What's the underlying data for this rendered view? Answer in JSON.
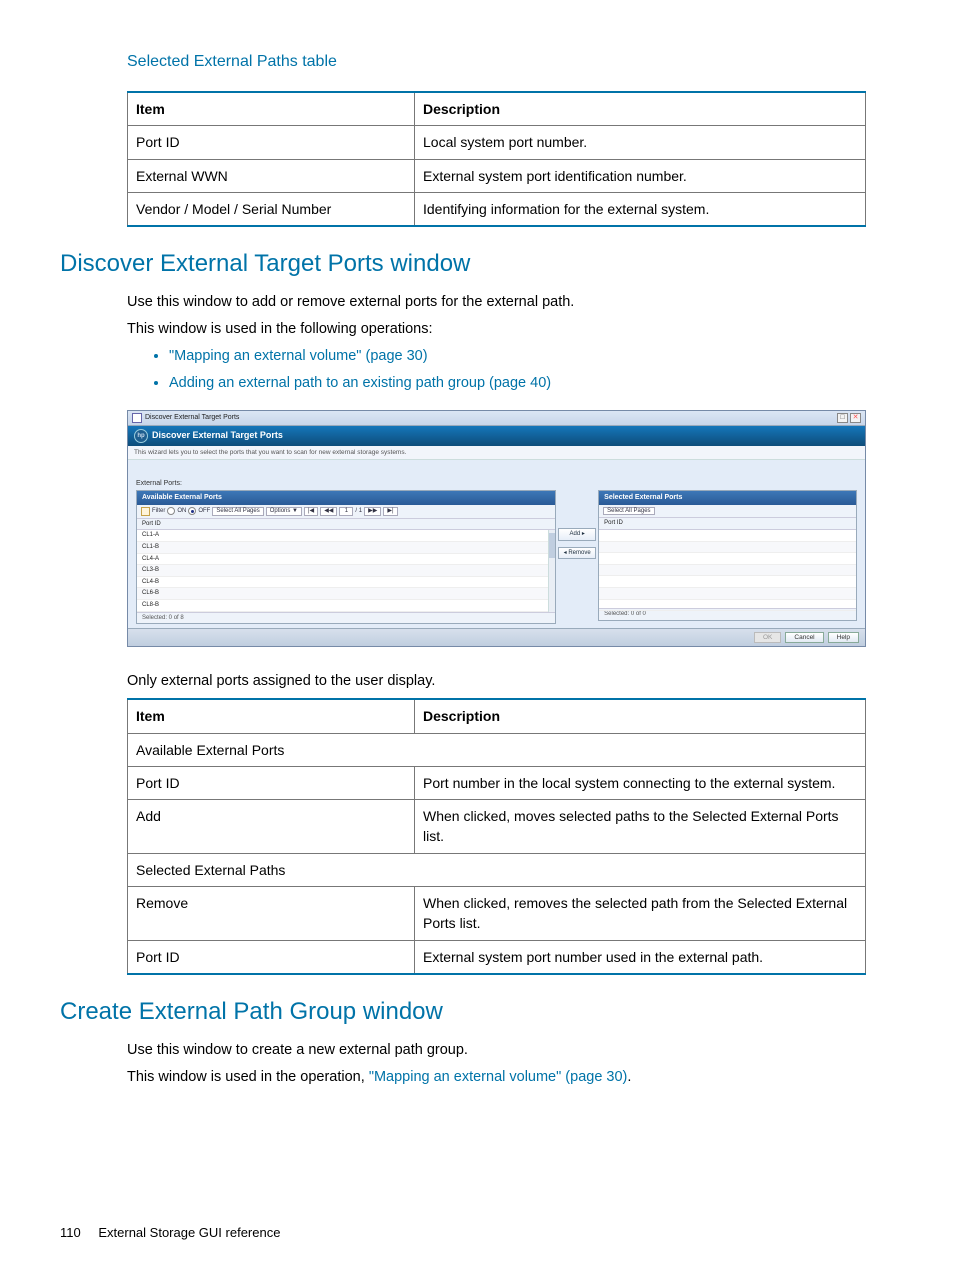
{
  "subheading1": "Selected External Paths table",
  "table1": {
    "headers": [
      "Item",
      "Description"
    ],
    "rows": [
      [
        "Port ID",
        "Local system port number."
      ],
      [
        "External WWN",
        "External system port identification number."
      ],
      [
        "Vendor / Model / Serial Number",
        "Identifying information for the external system."
      ]
    ]
  },
  "section1_title": "Discover External Target Ports window",
  "section1_p1": "Use this window to add or remove external ports for the external path.",
  "section1_p2": "This window is used in the following operations:",
  "bullets1": [
    {
      "text": "\"Mapping an external volume\" (page 30)",
      "link": true
    },
    {
      "text": "Adding an external path to an existing path group (page 40)",
      "link": true
    }
  ],
  "app": {
    "title": "Discover External Target Ports",
    "subtitle": "Discover External Target Ports",
    "desc": "This wizard lets you to select the ports that you want to scan for new external storage systems.",
    "ep_label": "External Ports:",
    "left_head": "Available External Ports",
    "right_head": "Selected External Ports",
    "filter_label": "Filter",
    "on_label": "ON",
    "off_label": "OFF",
    "select_all": "Select All Pages",
    "options": "Options ▼",
    "nav_first": "|◀",
    "nav_prev": "◀◀",
    "page_cur": "1",
    "page_sep": "/ 1",
    "nav_next": "▶▶",
    "nav_last": "▶|",
    "col_header": "Port ID",
    "rows_left": [
      "CL1-A",
      "CL1-B",
      "CL4-A",
      "CL3-B",
      "CL4-B",
      "CL6-B",
      "CL8-B"
    ],
    "add_btn": "Add ▸",
    "remove_btn": "◂ Remove",
    "selected_left": "Selected: 0   of  8",
    "selected_right": "Selected: 0   of  0",
    "ok": "OK",
    "cancel": "Cancel",
    "help": "Help"
  },
  "section1_p3": "Only external ports assigned to the user display.",
  "table2": {
    "headers": [
      "Item",
      "Description"
    ],
    "rows": [
      {
        "span": true,
        "text": "Available External Ports"
      },
      {
        "cells": [
          "Port ID",
          "Port number in the local system connecting to the external system."
        ]
      },
      {
        "cells": [
          "Add",
          "When clicked, moves selected paths to the Selected External Ports list."
        ]
      },
      {
        "span": true,
        "text": "Selected External Paths"
      },
      {
        "cells": [
          "Remove",
          "When clicked, removes the selected path from the Selected External Ports list."
        ]
      },
      {
        "cells": [
          "Port ID",
          "External system port number used in the external path."
        ]
      }
    ]
  },
  "section2_title": "Create External Path Group window",
  "section2_p1": "Use this window to create a new external path group.",
  "section2_p2_a": "This window is used in the operation, ",
  "section2_p2_link": "\"Mapping an external volume\" (page 30)",
  "section2_p2_b": ".",
  "footer_page": "110",
  "footer_text": "External Storage GUI reference",
  "chart_data": {
    "type": "table",
    "tables": [
      {
        "title": "Selected External Paths table",
        "columns": [
          "Item",
          "Description"
        ],
        "rows": [
          [
            "Port ID",
            "Local system port number."
          ],
          [
            "External WWN",
            "External system port identification number."
          ],
          [
            "Vendor / Model / Serial Number",
            "Identifying information for the external system."
          ]
        ]
      },
      {
        "title": "Discover External Target Ports items",
        "columns": [
          "Item",
          "Description"
        ],
        "rows": [
          [
            "Available External Ports",
            ""
          ],
          [
            "Port ID",
            "Port number in the local system connecting to the external system."
          ],
          [
            "Add",
            "When clicked, moves selected paths to the Selected External Ports list."
          ],
          [
            "Selected External Paths",
            ""
          ],
          [
            "Remove",
            "When clicked, removes the selected path from the Selected External Ports list."
          ],
          [
            "Port ID",
            "External system port number used in the external path."
          ]
        ]
      }
    ]
  }
}
